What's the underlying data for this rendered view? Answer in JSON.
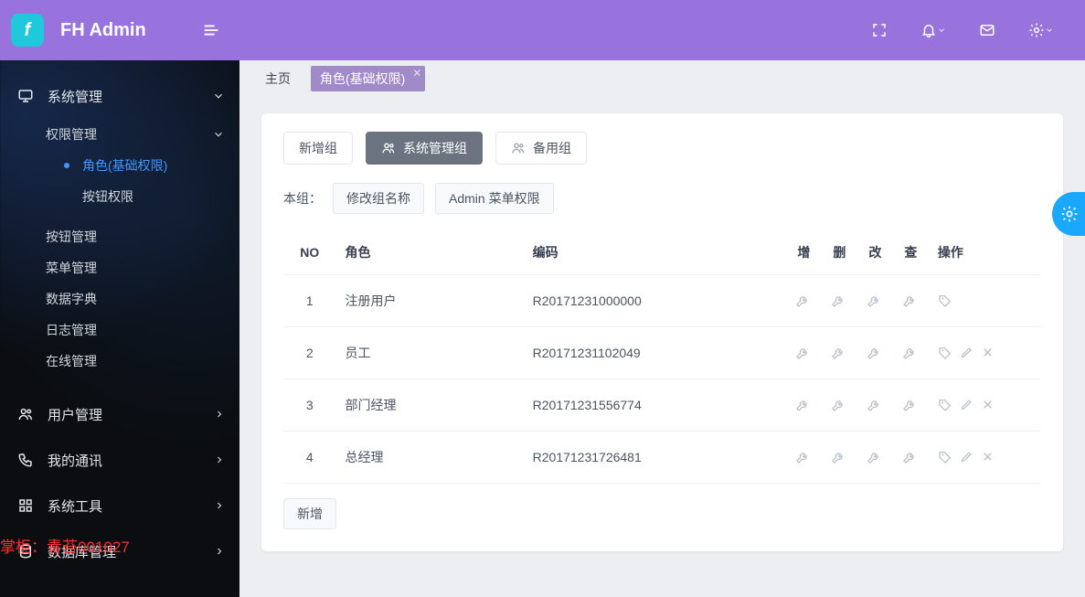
{
  "brand": "FH Admin",
  "sidebar": {
    "items": [
      {
        "label": "系统管理",
        "open": true
      },
      {
        "label": "用户管理"
      },
      {
        "label": "我的通讯"
      },
      {
        "label": "系统工具"
      },
      {
        "label": "数据库管理"
      }
    ],
    "sys_sub": {
      "perm_mgmt": "权限管理",
      "perm_sub": [
        {
          "label": "角色(基础权限)",
          "active": true
        },
        {
          "label": "按钮权限"
        }
      ],
      "others": [
        "按钮管理",
        "菜单管理",
        "数据字典",
        "日志管理",
        "在线管理"
      ]
    }
  },
  "tabs": {
    "home": "主页",
    "active": "角色(基础权限)"
  },
  "toolbar": {
    "add_group": "新增组",
    "sys_group": "系统管理组",
    "backup_group": "备用组",
    "this_group": "本组：",
    "rename_group": "修改组名称",
    "admin_menu_perm": "Admin 菜单权限"
  },
  "table": {
    "headers": {
      "no": "NO",
      "role": "角色",
      "code": "编码",
      "add": "增",
      "del": "删",
      "edit": "改",
      "view": "查",
      "ops": "操作"
    },
    "rows": [
      {
        "no": "1",
        "role": "注册用户",
        "code": "R20171231000000",
        "deletable": false
      },
      {
        "no": "2",
        "role": "员工",
        "code": "R20171231102049",
        "deletable": true
      },
      {
        "no": "3",
        "role": "部门经理",
        "code": "R20171231556774",
        "deletable": true
      },
      {
        "no": "4",
        "role": "总经理",
        "code": "R20171231726481",
        "deletable": true
      }
    ],
    "add_btn": "新增"
  },
  "watermark": "掌柜：青苔001027"
}
